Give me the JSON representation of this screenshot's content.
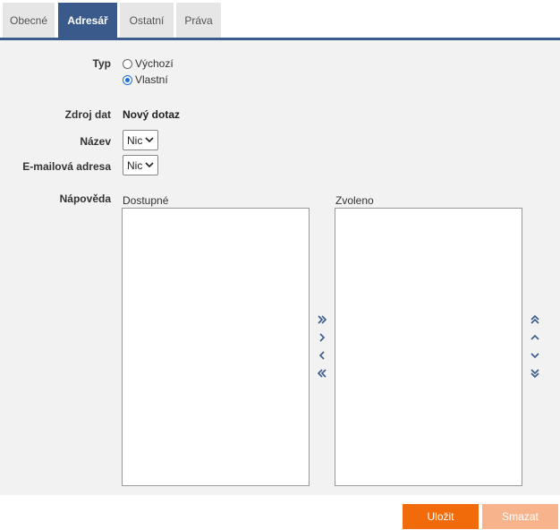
{
  "tabs": [
    {
      "label": "Obecné",
      "active": false
    },
    {
      "label": "Adresář",
      "active": true
    },
    {
      "label": "Ostatní",
      "active": false
    },
    {
      "label": "Práva",
      "active": false
    }
  ],
  "form": {
    "typ_label": "Typ",
    "typ_options": [
      {
        "label": "Výchozí",
        "checked": false
      },
      {
        "label": "Vlastní",
        "checked": true
      }
    ],
    "zdroj_label": "Zdroj dat",
    "zdroj_value": "Nový dotaz",
    "nazev_label": "Název",
    "nazev_value": "Nic",
    "email_label": "E-mailová adresa",
    "email_value": "Nic",
    "napoveda_label": "Nápověda",
    "available_caption": "Dostupné",
    "selected_caption": "Zvoleno"
  },
  "buttons": {
    "save": "Uložit",
    "delete": "Smazat"
  },
  "colors": {
    "accent": "#3a5a8c",
    "save": "#f26b0a",
    "delete_disabled": "#f7b48c"
  }
}
